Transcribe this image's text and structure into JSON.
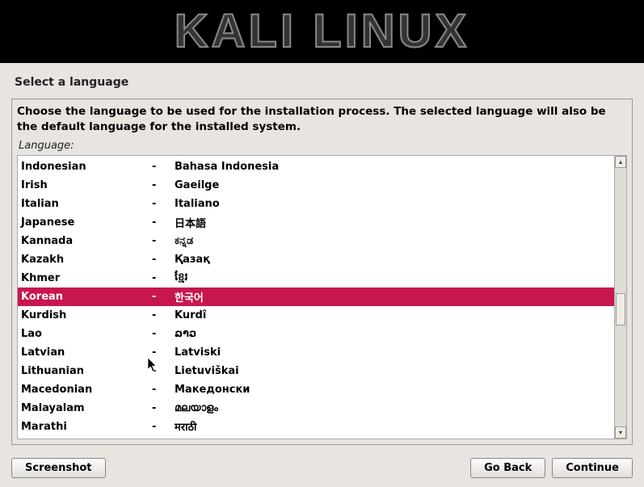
{
  "banner": {
    "title": "KALI LINUX"
  },
  "step_title": "Select a language",
  "instructions": "Choose the language to be used for the installation process. The selected language will also be the default language for the installed system.",
  "field_label": "Language:",
  "selected_index": 7,
  "languages": [
    {
      "english": "Indonesian",
      "native": "Bahasa Indonesia"
    },
    {
      "english": "Irish",
      "native": "Gaeilge"
    },
    {
      "english": "Italian",
      "native": "Italiano"
    },
    {
      "english": "Japanese",
      "native": "日本語"
    },
    {
      "english": "Kannada",
      "native": "ಕನ್ನಡ"
    },
    {
      "english": "Kazakh",
      "native": "Қазақ"
    },
    {
      "english": "Khmer",
      "native": "ខ្មែរ"
    },
    {
      "english": "Korean",
      "native": "한국어"
    },
    {
      "english": "Kurdish",
      "native": "Kurdî"
    },
    {
      "english": "Lao",
      "native": "ລາວ"
    },
    {
      "english": "Latvian",
      "native": "Latviski"
    },
    {
      "english": "Lithuanian",
      "native": "Lietuviškai"
    },
    {
      "english": "Macedonian",
      "native": "Македонски"
    },
    {
      "english": "Malayalam",
      "native": "മലയാളം"
    },
    {
      "english": "Marathi",
      "native": "मराठी"
    }
  ],
  "buttons": {
    "screenshot": "Screenshot",
    "goback": "Go Back",
    "continue": "Continue"
  }
}
